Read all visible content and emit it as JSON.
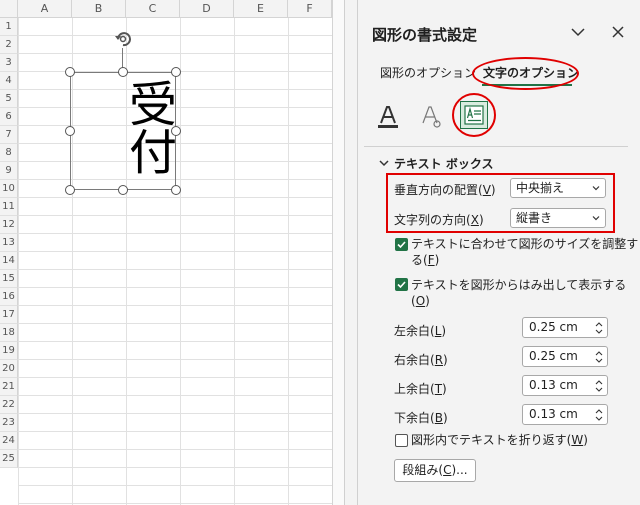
{
  "sheet": {
    "columns": [
      "A",
      "B",
      "C",
      "D",
      "E",
      "F"
    ],
    "rows": [
      "1",
      "2",
      "3",
      "4",
      "5",
      "6",
      "7",
      "8",
      "9",
      "10",
      "11",
      "12",
      "13",
      "14",
      "15",
      "16",
      "17",
      "18",
      "19",
      "20",
      "21",
      "22",
      "23",
      "24",
      "25"
    ],
    "shape_text": "受付"
  },
  "pane": {
    "title": "図形の書式設定",
    "tabs": [
      {
        "label": "図形のオプション",
        "active": false
      },
      {
        "label": "文字のオプション",
        "active": true
      }
    ],
    "icons": [
      "text-fill-icon",
      "text-outline-icon",
      "textbox-icon"
    ],
    "section_title": "テキスト ボックス",
    "vertical_align": {
      "label": "垂直方向の配置",
      "accel": "V",
      "value": "中央揃え"
    },
    "text_direction": {
      "label": "文字列の方向",
      "accel": "X",
      "value": "縦書き"
    },
    "resize_check": {
      "label_1": "テキストに合わせて図形のサイズを調整す",
      "label_2": "る",
      "accel": "F",
      "checked": true
    },
    "overflow_check": {
      "label": "テキストを図形からはみ出して表示する",
      "accel": "O",
      "checked": true
    },
    "margins": [
      {
        "label": "左余白",
        "accel": "L",
        "value": "0.25 cm"
      },
      {
        "label": "右余白",
        "accel": "R",
        "value": "0.25 cm"
      },
      {
        "label": "上余白",
        "accel": "T",
        "value": "0.13 cm"
      },
      {
        "label": "下余白",
        "accel": "B",
        "value": "0.13 cm"
      }
    ],
    "wrap_check": {
      "label": "図形内でテキストを折り返す",
      "accel": "W",
      "checked": false
    },
    "columns_button": {
      "label": "段組み",
      "accel": "C",
      "suffix": "..."
    },
    "accent_color": "#217346",
    "highlight_color": "#e00000"
  }
}
